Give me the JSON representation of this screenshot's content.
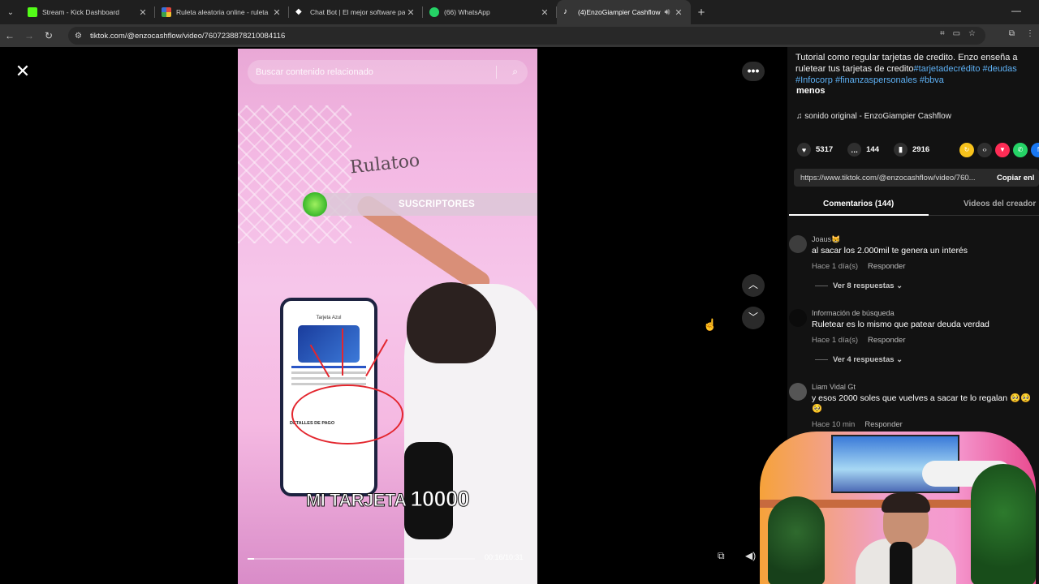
{
  "browser": {
    "tabs": [
      {
        "title": "Stream - Kick Dashboard",
        "favicon_color": "#53fc18",
        "active": false
      },
      {
        "title": "Ruleta aleatoria online - ruleta",
        "favicon_color": "#e0483e",
        "active": false
      },
      {
        "title": "Chat Bot | El mejor software pa",
        "favicon_color": "#ffffff",
        "active": false
      },
      {
        "title": "(66) WhatsApp",
        "favicon_color": "#25d366",
        "active": false
      },
      {
        "title": "(4)EnzoGiampier Cashflow",
        "favicon_color": "#ffffff",
        "active": true
      }
    ],
    "url": "tiktok.com/@enzocashflow/video/7607238878210084116"
  },
  "video": {
    "search_placeholder": "Buscar contenido relacionado",
    "whiteboard_text": "Rulatoo",
    "subscribe_text": "SUSCRIPTORES",
    "caption_text": "MI TARJETA ",
    "caption_number": "10000",
    "phone_header": "Tarjeta Azul",
    "phone_details": "DETALLES DE PAGO",
    "progress_fraction": 0.03,
    "timecode": "00:16/10:31"
  },
  "panel": {
    "description_parts": [
      {
        "text": "Tutorial como regular tarjetas de credito. Enzo enseña a ruletear tus tarjetas de credito",
        "tag": false
      },
      {
        "text": "#tarjetadecrédito",
        "tag": true
      },
      {
        "text": " ",
        "tag": false
      },
      {
        "text": "#deudas",
        "tag": true
      },
      {
        "text": " ",
        "tag": false
      },
      {
        "text": "#Infocorp",
        "tag": true
      },
      {
        "text": " ",
        "tag": false
      },
      {
        "text": "#finanzaspersonales",
        "tag": true
      },
      {
        "text": " ",
        "tag": false
      },
      {
        "text": "#bbva",
        "tag": true
      }
    ],
    "less_label": "menos",
    "music": "sonido original - EnzoGiampier Cashflow",
    "likes": "5317",
    "comments": "144",
    "saves": "2916",
    "link": "https://www.tiktok.com/@enzocashflow/video/760...",
    "copy_label": "Copiar enl",
    "tab_comments": "Comentarios (144)",
    "tab_creator": "Videos del creador",
    "comment_list": [
      {
        "user": "Joaus😸",
        "text": "al sacar los 2.000mil te genera un interés",
        "time": "Hace 1 día(s)",
        "reply": "Responder",
        "replies": "Ver 8 respuestas ⌄"
      },
      {
        "user": "Información de búsqueda",
        "text": "Ruletear es lo mismo que patear deuda verdad",
        "time": "Hace 1 día(s)",
        "reply": "Responder",
        "replies": "Ver 4 respuestas ⌄"
      },
      {
        "user": "Liam Vidal Gt",
        "text": "y esos 2000 soles que vuelves a sacar te lo regalan 🥺🥺🥺",
        "time": "Hace 10 min",
        "reply": "Responder",
        "replies": ""
      }
    ]
  },
  "colors": {
    "accent_link": "#5eb1f5",
    "tiktok_red": "#fe2c55"
  }
}
